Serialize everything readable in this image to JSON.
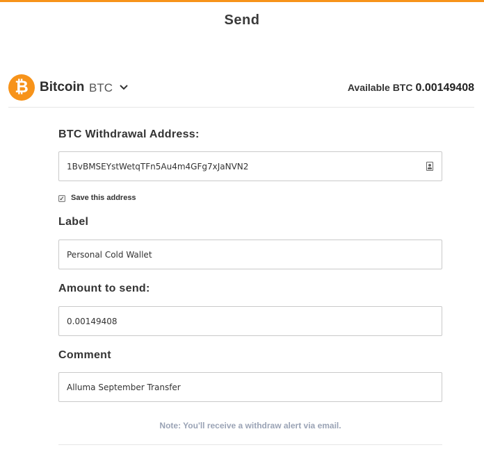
{
  "page": {
    "title": "Send"
  },
  "colors": {
    "accent": "#f7931a",
    "note": "#9aa3b5"
  },
  "coin": {
    "logo_glyph": "₿",
    "name": "Bitcoin",
    "symbol": "BTC",
    "available_label": "Available BTC",
    "available_value": "0.00149408"
  },
  "form": {
    "address": {
      "label": "BTC Withdrawal Address:",
      "value": "1BvBMSEYstWetqTFn5Au4m4GFg7xJaNVN2"
    },
    "save_address": {
      "label": "Save this address",
      "checked": true
    },
    "label_field": {
      "label": "Label",
      "value": "Personal Cold Wallet"
    },
    "amount": {
      "label": "Amount to send:",
      "value": "0.00149408"
    },
    "comment": {
      "label": "Comment",
      "value": "Alluma September Transfer"
    },
    "note": "Note: You'll receive a withdraw alert via email."
  }
}
